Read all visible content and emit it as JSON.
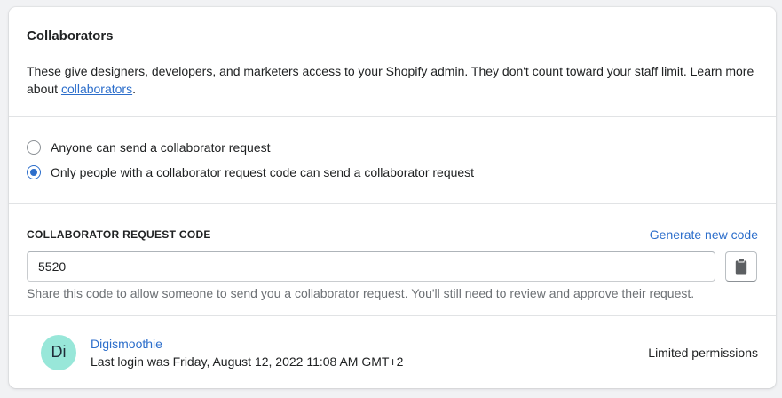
{
  "card": {
    "title": "Collaborators",
    "description_prefix": "These give designers, developers, and marketers access to your Shopify admin. They don't count toward your staff limit. Learn more about ",
    "description_link": "collaborators",
    "description_suffix": "."
  },
  "request_options": [
    {
      "label": "Anyone can send a collaborator request",
      "checked": false
    },
    {
      "label": "Only people with a collaborator request code can send a collaborator request",
      "checked": true
    }
  ],
  "code_section": {
    "title": "Collaborator request code",
    "generate_label": "Generate new code",
    "code_value": "5520",
    "copy_icon": "clipboard-icon",
    "help_text": "Share this code to allow someone to send you a collaborator request. You'll still need to review and approve their request."
  },
  "collaborator": {
    "initials": "Di",
    "name": "Digismoothie",
    "last_login": "Last login was Friday, August 12, 2022 11:08 AM GMT+2",
    "permissions": "Limited permissions"
  },
  "colors": {
    "accent": "#2c6ecb",
    "avatar_bg": "#98e7d9",
    "page_bg": "#f1f2f4"
  }
}
